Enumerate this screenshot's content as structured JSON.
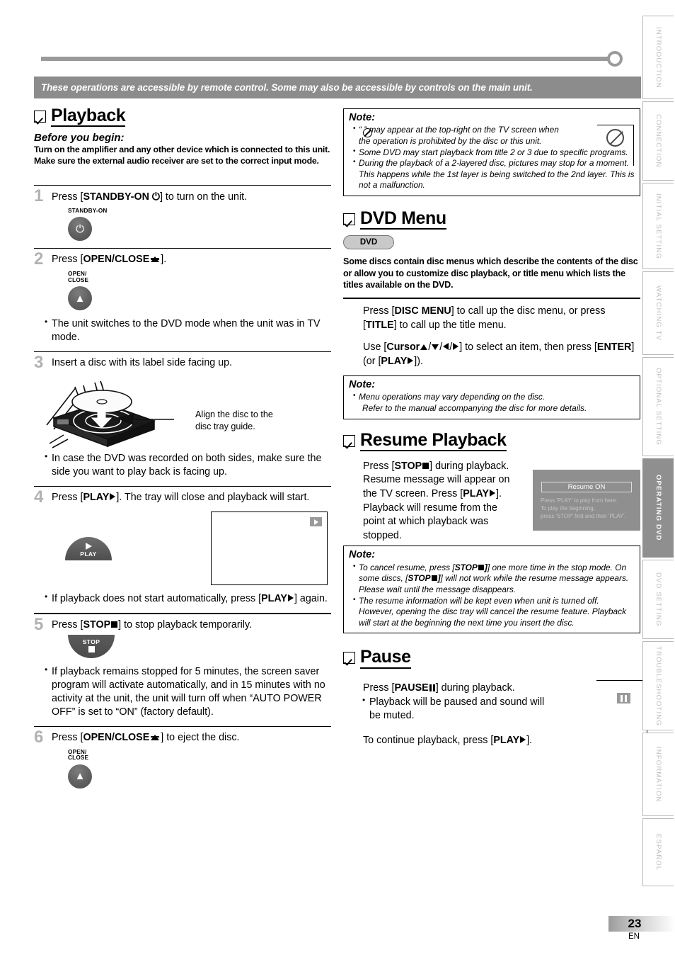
{
  "banner": {
    "text": "These operations are accessible by remote control. Some may also be accessible by controls on the main unit."
  },
  "left_column": {
    "section": {
      "title": "Playback",
      "checkbox_icon": "checkbox-checked-icon"
    },
    "before_you_begin": {
      "heading": "Before you begin:",
      "line1": "Turn on the amplifier and any other device which is connected to this unit.",
      "line2": "Make sure the external audio receiver are set to the correct input mode."
    },
    "steps": [
      {
        "number": "1",
        "text_pre": "Press [",
        "text_bold": "STANDBY-ON",
        "text_post": "] to turn on the unit.",
        "button_caption": "STANDBY-ON",
        "button_glyph": "power-icon"
      },
      {
        "number": "2",
        "text_pre": "Press [",
        "text_bold": "OPEN/CLOSE",
        "text_post": "].",
        "button_caption_l1": "OPEN/",
        "button_caption_l2": "CLOSE",
        "button_glyph": "eject-icon",
        "bullets": [
          "The unit switches to the DVD mode when the unit was in TV mode."
        ]
      },
      {
        "number": "3",
        "text": "Insert a disc with its label side facing up.",
        "callout_l1": "Align the disc to the",
        "callout_l2": "disc tray guide.",
        "bullets": [
          "In case the DVD was recorded on both sides, make sure the side you want to play back is facing up."
        ]
      },
      {
        "number": "4",
        "text_pre": "Press [",
        "text_bold": "PLAY",
        "text_post": "]. The tray will close and playback will start.",
        "button_label": "PLAY",
        "button_glyph": "play-icon",
        "screen_icon": "play-indicator-icon",
        "bullets_pre": "If playback does not start automatically, press [",
        "bullets_bold": "PLAY",
        "bullets_post": "] again."
      },
      {
        "number": "5",
        "text_pre": "Press [",
        "text_bold": "STOP",
        "text_post": "] to stop playback temporarily.",
        "button_label": "STOP",
        "button_glyph": "stop-icon",
        "bullets": [
          "If playback remains stopped for 5 minutes, the screen saver program will activate automatically, and in 15 minutes with no activity at the unit, the unit will turn off when “AUTO POWER OFF” is set to “ON” (factory default)."
        ]
      },
      {
        "number": "6",
        "text_pre": "Press [",
        "text_bold": "OPEN/CLOSE",
        "text_post": "] to eject the disc.",
        "button_caption_l1": "OPEN/",
        "button_caption_l2": "CLOSE",
        "button_glyph": "eject-icon"
      }
    ]
  },
  "right_column": {
    "note_playback": {
      "title": "Note:",
      "items": [
        "“   ” may appear at the top-right on the TV screen when the operation is prohibited by the disc or this unit.",
        "Some DVD may start playback from title 2 or 3 due to specific programs.",
        "During the playback of a 2-layered disc, pictures may stop for a moment. This happens while the 1st layer is being switched to the 2nd layer. This is not a malfunction."
      ],
      "prohibit_icon": "prohibited-icon"
    },
    "dvd_menu": {
      "title": "DVD Menu",
      "badge": "DVD",
      "intro": "Some discs contain disc menus which describe the contents of the disc or allow you to customize disc playback, or title menu which lists the titles available on the DVD.",
      "para1_pre": "Press [",
      "para1_b1": "DISC MENU",
      "para1_mid": "] to call up the disc menu, or press [",
      "para1_b2": "TITLE",
      "para1_post": "] to call up the title menu.",
      "para2_pre": "Use [",
      "para2_b1": "Cursor",
      "para2_mid": "] to select an item, then press [",
      "para2_b2": "ENTER",
      "para2_mid2": "] (or [",
      "para2_b3": "PLAY",
      "para2_post": "]).",
      "note": {
        "title": "Note:",
        "line1": "Menu operations may vary depending on the disc.",
        "line2": "Refer to the manual accompanying the disc for more details."
      }
    },
    "resume_playback": {
      "title": "Resume Playback",
      "para1_pre": "Press [",
      "para1_bold": "STOP",
      "para1_post": "] during playback. Resume message will appear on the TV screen.",
      "para2_pre": "Press [",
      "para2_bold": "PLAY",
      "para2_post": "]. Playback will resume from the point at which playback was stopped.",
      "screen": {
        "title": "Resume ON",
        "line1": "Press 'PLAY' to play from here.",
        "line2": "To play the beginning,",
        "line3": "press 'STOP' first and then 'PLAY'."
      },
      "note": {
        "title": "Note:",
        "item1_a": "To cancel resume, press [",
        "item1_b": "STOP",
        "item1_c": "] one more time in the stop mode. On some discs, [",
        "item1_d": "STOP",
        "item1_e": "] will not work while the resume message appears. Please wait until the message disappears.",
        "item2": "The resume information will be kept even when unit is turned off. However, opening the disc tray will cancel the resume feature. Playback will start at the beginning the next time you insert the disc."
      }
    },
    "pause": {
      "title": "Pause",
      "para1_pre": "Press [",
      "para1_bold": "PAUSE",
      "para1_post": "] during playback.",
      "bullet": "Playback will be paused and sound will be muted.",
      "para2_pre": "To continue playback, press [",
      "para2_bold": "PLAY",
      "para2_post": "].",
      "pause_icon": "pause-indicator-icon"
    }
  },
  "side_tabs": [
    {
      "label": "INTRODUCTION",
      "active": false
    },
    {
      "label": "CONNECTION",
      "active": false
    },
    {
      "label": "INITIAL  SETTING",
      "active": false
    },
    {
      "label": "WATCHING  TV",
      "active": false
    },
    {
      "label": "OPTIONAL  SETTING",
      "active": false
    },
    {
      "label": "OPERATING  DVD",
      "active": true
    },
    {
      "label": "DVD  SETTING",
      "active": false
    },
    {
      "label": "TROUBLESHOOTING",
      "active": false
    },
    {
      "label": "INFORMATION",
      "active": false
    },
    {
      "label": "ESPAÑOL",
      "active": false
    }
  ],
  "footer": {
    "page_number": "23",
    "language_code": "EN"
  },
  "colors": {
    "banner_bg": "#8c8c8c",
    "tab_active_bg": "#8f8f8f",
    "step_number": "#b2b2b2",
    "screen_bg": "#8f8f8f"
  }
}
